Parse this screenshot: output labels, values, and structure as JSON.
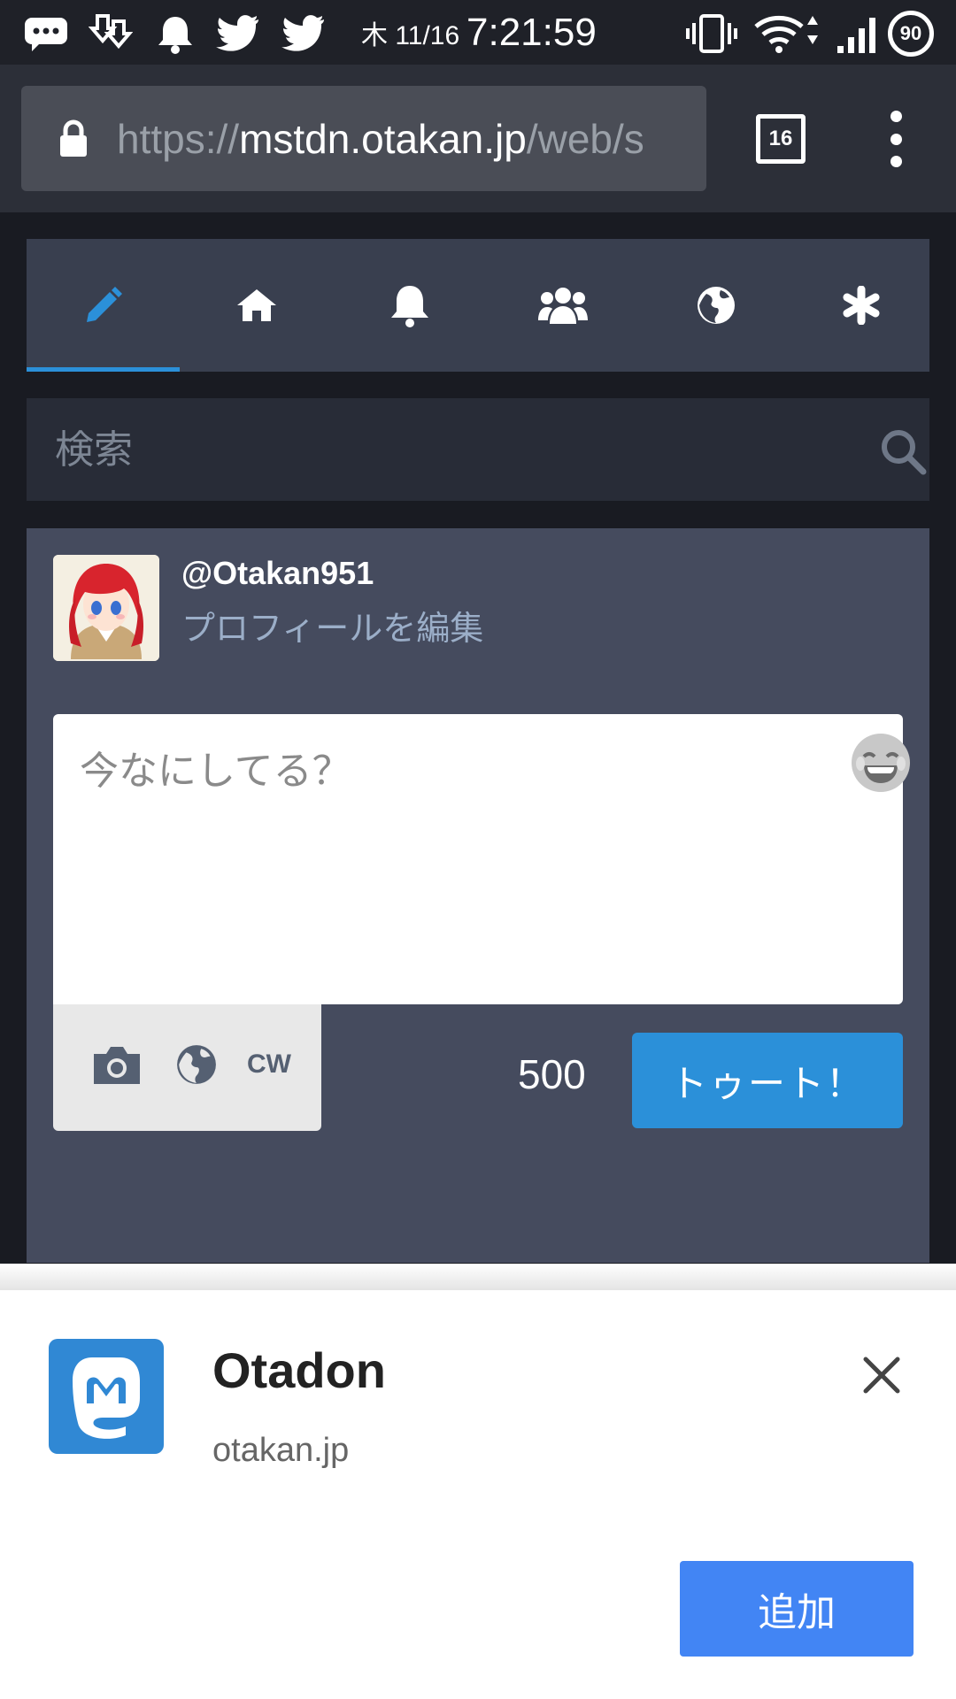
{
  "status_bar": {
    "date": "木 11/16",
    "time": "7:21:59",
    "battery": "90",
    "icons": [
      "messages-icon",
      "download-icon",
      "notification-bell-icon",
      "twitter-icon",
      "twitter-icon",
      "vibrate-icon",
      "wifi-icon",
      "signal-icon",
      "battery-icon"
    ]
  },
  "browser": {
    "url_scheme": "https://",
    "url_host": "mstdn.otakan.jp",
    "url_path": "/web/s",
    "tab_count": "16"
  },
  "nav": {
    "tabs": [
      "compose-icon",
      "home-icon",
      "notifications-icon",
      "local-timeline-icon",
      "federated-timeline-icon",
      "getting-started-icon"
    ],
    "active_index": 0,
    "accent": "#2b90d9"
  },
  "search": {
    "placeholder": "検索"
  },
  "compose": {
    "username": "@Otakan951",
    "edit_profile": "プロフィールを編集",
    "placeholder": "今なにしてる？",
    "cw_label": "CW",
    "char_count": "500",
    "toot_label": "トゥート！"
  },
  "install_sheet": {
    "app_name": "Otadon",
    "domain": "otakan.jp",
    "add_label": "追加"
  },
  "colors": {
    "background": "#191b22",
    "panel": "#454b5e",
    "tabs": "#393f4f",
    "accent_blue": "#2b90d9",
    "add_button": "#4285f4"
  }
}
